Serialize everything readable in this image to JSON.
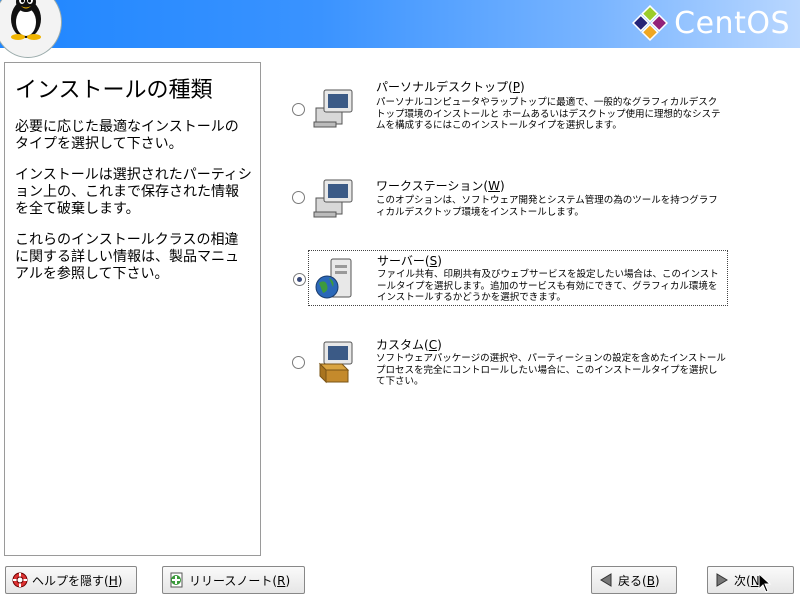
{
  "header": {
    "brand": "CentOS",
    "brand_colors": [
      "#9ccd2a",
      "#932279",
      "#efa724",
      "#262577"
    ]
  },
  "help": {
    "title": "インストールの種類",
    "paragraphs": [
      "必要に応じた最適なインストールのタイプを選択して下さい。",
      "インストールは選択されたパーティション上の、これまで保存された情報を全て破棄します。",
      "これらのインストールクラスの相違に関する詳しい情報は、製品マニュアルを参照して下さい。"
    ]
  },
  "options": [
    {
      "title": "パーソナルデスクトップ(",
      "key": "P",
      "title_end": ")",
      "desc": "パーソナルコンピュータやラップトップに最適で、一般的なグラフィカルデスクトップ環境のインストールと ホームあるいはデスクトップ使用に理想的なシステムを構成するにはこのインストールタイプを選択します。",
      "icon": "desktop-computer-icon",
      "selected": false
    },
    {
      "title": "ワークステーション(",
      "key": "W",
      "title_end": ")",
      "desc": "このオプションは、ソフトウェア開発とシステム管理の為のツールを持つグラフィカルデスクトップ環境をインストールします。",
      "icon": "workstation-computer-icon",
      "selected": false
    },
    {
      "title": "サーバー(",
      "key": "S",
      "title_end": ")",
      "desc": "ファイル共有、印刷共有及びウェブサービスを設定したい場合は、このインストールタイプを選択します。追加のサービスも有効にできて、グラフィカル環境を インストールするかどうかを選択できます。",
      "icon": "server-globe-icon",
      "selected": true
    },
    {
      "title": "カスタム(",
      "key": "C",
      "title_end": ")",
      "desc": "ソフトウェアパッケージの選択や、パーティーションの設定を含めたインストールプロセスを完全にコントロールしたい場合に、このインストールタイプを選択して下さい。",
      "icon": "custom-package-icon",
      "selected": false
    }
  ],
  "buttons": {
    "hide_help": {
      "label": "ヘルプを隠す(",
      "key": "H",
      "end": ")"
    },
    "release_notes": {
      "label": "リリースノート(",
      "key": "R",
      "end": ")"
    },
    "back": {
      "label": "戻る(",
      "key": "B",
      "end": ")"
    },
    "next": {
      "label": "次(",
      "key": "N",
      "end": ")"
    }
  }
}
